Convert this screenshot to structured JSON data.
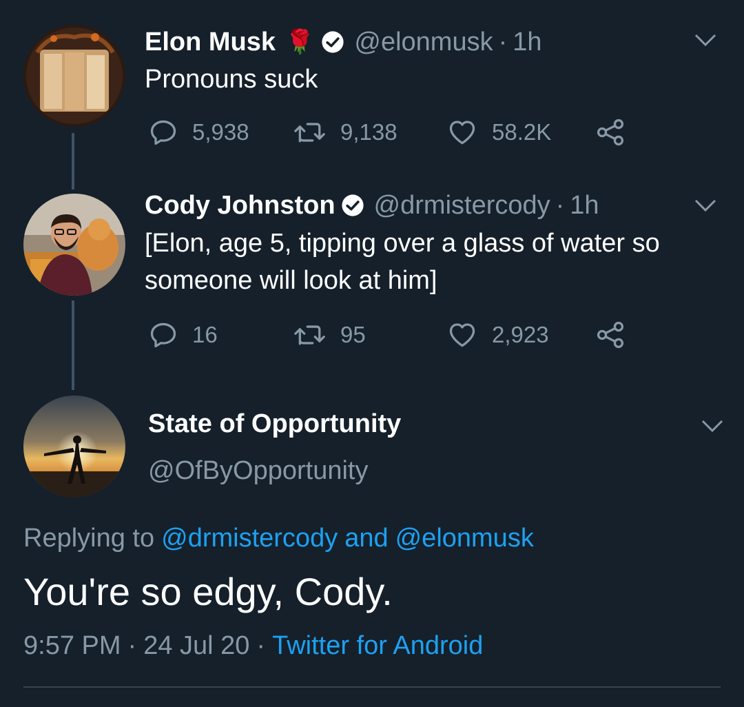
{
  "tweets": [
    {
      "name": "Elon Musk",
      "emoji": "🌹",
      "handle": "@elonmusk",
      "dot": "·",
      "time": "1h",
      "text_lines": [
        "Pronouns suck"
      ],
      "replies": "5,938",
      "retweets": "9,138",
      "likes": "58.2K"
    },
    {
      "name": "Cody Johnston",
      "handle": "@drmistercody",
      "dot": "·",
      "time": "1h",
      "text_lines": [
        "[Elon, age 5, tipping over a glass of water so",
        "someone will look at him]"
      ],
      "replies": "16",
      "retweets": "95",
      "likes": "2,923"
    }
  ],
  "main_tweet": {
    "name": "State of Opportunity",
    "handle": "@OfByOpportunity",
    "replying_prefix": "Replying to",
    "mention_1": "@drmistercody",
    "and_word": "and",
    "mention_2": "@elonmusk",
    "text": "You're so edgy, Cody.",
    "time": "9:57 PM",
    "dot": "·",
    "date": "24 Jul 20",
    "source": "Twitter for Android"
  },
  "colors": {
    "background": "#15202b",
    "secondary_text": "#8899a6",
    "link": "#1da1f2",
    "thread_line": "#3d5466"
  }
}
